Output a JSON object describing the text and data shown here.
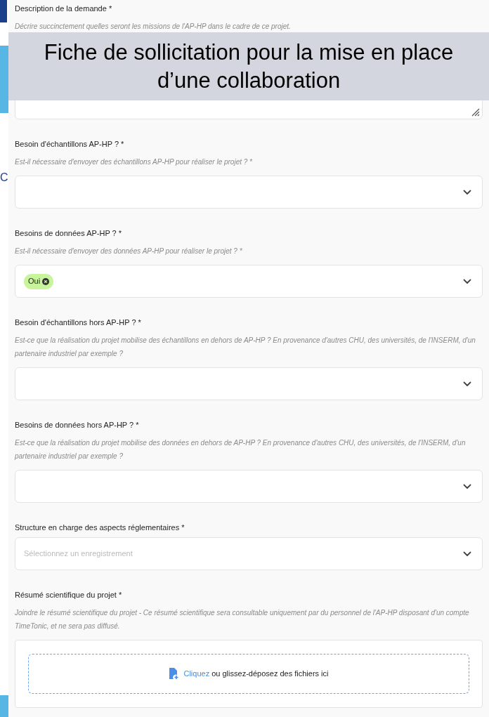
{
  "slide": {
    "banner": "Fiche de sollicitation pour la mise en place d’une collaboration",
    "letter": "C"
  },
  "fields": [
    {
      "kind": "textarea",
      "label": "Description de la demande *",
      "hint": "Décrire succinctement quelles seront les missions de l'AP-HP dans le cadre de ce projet."
    },
    {
      "kind": "select",
      "label": "Besoin d'échantillons AP-HP ? *",
      "hint": "Est-il nécessaire d'envoyer des échantillons AP-HP pour réaliser le projet ? *"
    },
    {
      "kind": "select",
      "label": "Besoins de données AP-HP ? *",
      "hint": "Est-il nécessaire d'envoyer des données AP-HP pour réaliser le projet ? *",
      "chips": [
        "Oui"
      ]
    },
    {
      "kind": "select",
      "label": "Besoin d'échantillons hors AP-HP ? *",
      "hint": "Est-ce que la réalisation du projet mobilise des échantillons en dehors de AP-HP ? En provenance d'autres CHU, des universités, de l'INSERM, d'un partenaire industriel par exemple ?"
    },
    {
      "kind": "select",
      "label": "Besoins de données hors AP-HP ? *",
      "hint": "Est-ce que la réalisation du projet mobilise des données en dehors de AP-HP ? En provenance d'autres CHU, des universités, de l'INSERM, d'un partenaire industriel par exemple ?"
    },
    {
      "kind": "select",
      "label": "Structure en charge des aspects réglementaires *",
      "placeholder": "Sélectionnez un enregistrement"
    },
    {
      "kind": "upload",
      "label": "Résumé scientifique du projet *",
      "hint": "Joindre le résumé scientifique du projet - Ce résumé scientifique sera consultable uniquement par du personnel de l'AP-HP disposant d'un compte TimeTonic, et ne sera pas diffusé.",
      "link": "Cliquez",
      "text": "ou glissez-déposez des fichiers ici"
    }
  ]
}
